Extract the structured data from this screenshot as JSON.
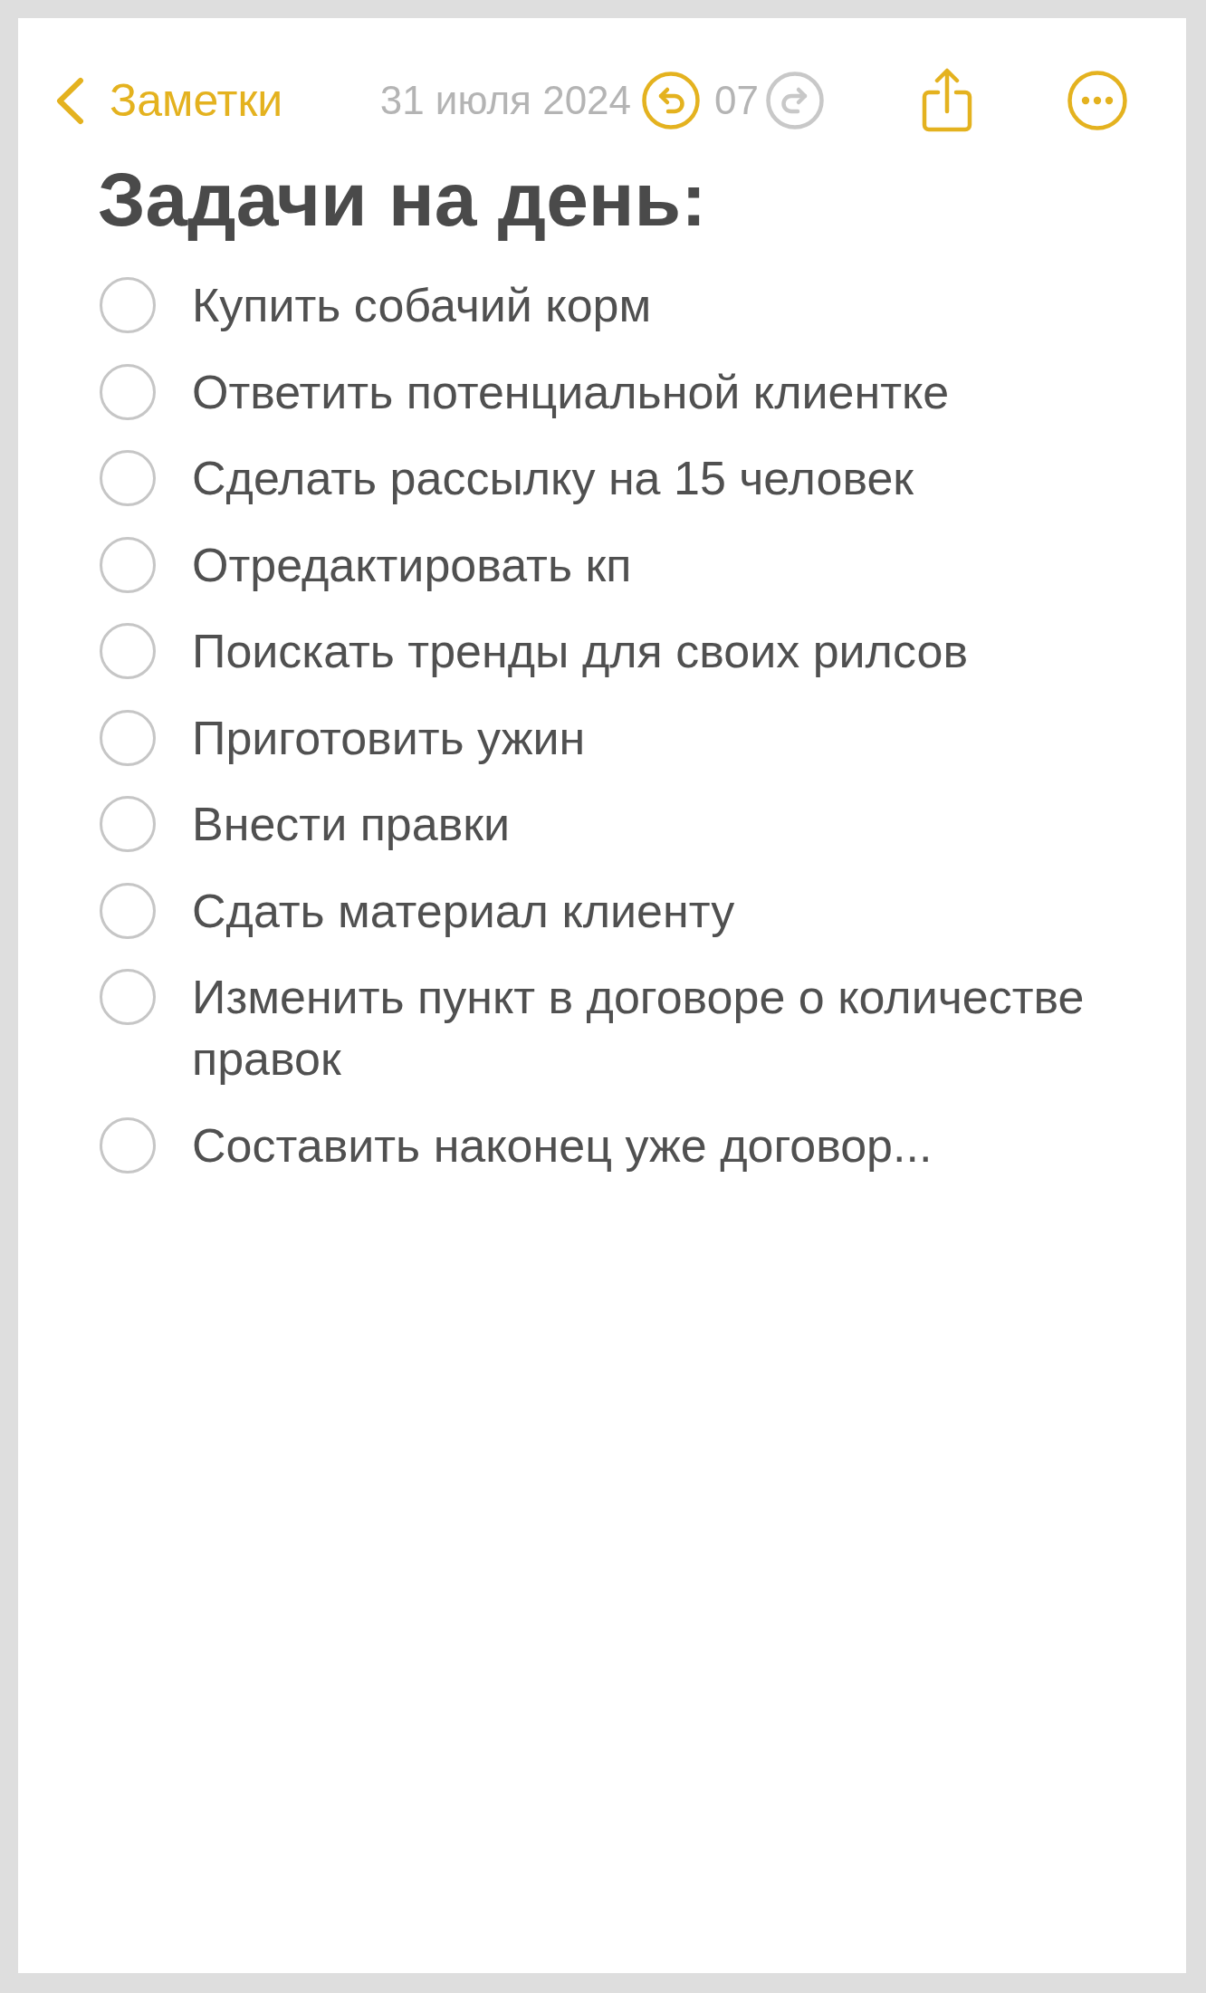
{
  "nav": {
    "back_label": "Заметки",
    "date_parts": [
      "31 июля 2024",
      "07"
    ]
  },
  "toolbar": [
    {
      "kind": "undo",
      "disabled": false
    },
    {
      "kind": "redo",
      "disabled": true
    },
    {
      "kind": "share",
      "disabled": false
    },
    {
      "kind": "more",
      "disabled": false
    }
  ],
  "note": {
    "title": "Задачи на день:",
    "checklist": [
      {
        "text": "Купить собачий корм",
        "checked": false
      },
      {
        "text": "Ответить потенциальной клиентке",
        "checked": false
      },
      {
        "text": "Сделать рассылку на 15 человек",
        "checked": false
      },
      {
        "text": "Отредактировать кп",
        "checked": false
      },
      {
        "text": "Поискать тренды для своих рилсов",
        "checked": false
      },
      {
        "text": "Приготовить ужин",
        "checked": false
      },
      {
        "text": "Внести правки",
        "checked": false
      },
      {
        "text": "Сдать материал клиенту",
        "checked": false
      },
      {
        "text": "Изменить пункт в договоре о количестве правок",
        "checked": false
      },
      {
        "text": "Составить наконец уже договор...",
        "checked": false
      }
    ]
  }
}
